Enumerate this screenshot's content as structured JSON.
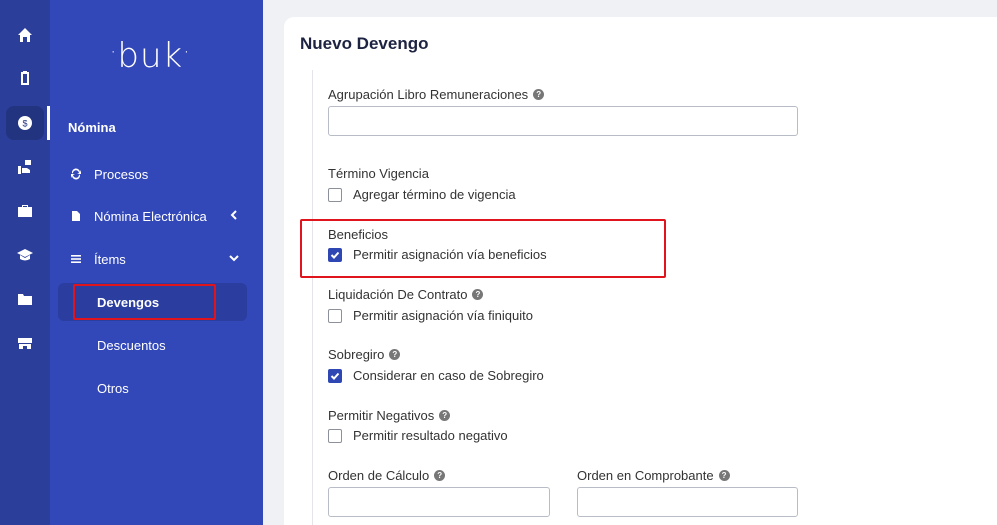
{
  "rail": {
    "icons": [
      "home-icon",
      "clipboard-icon",
      "dollar-icon",
      "hand-coin-icon",
      "briefcase-icon",
      "graduation-cap-icon",
      "folder-icon",
      "store-icon"
    ]
  },
  "nav": {
    "logo": "buk",
    "section": "Nómina",
    "items": [
      {
        "label": "Procesos",
        "icon": "sync-icon"
      },
      {
        "label": "Nómina Electrónica",
        "icon": "document-icon"
      },
      {
        "label": "Ítems",
        "icon": "list-icon"
      }
    ],
    "sub_items": [
      {
        "label": "Devengos"
      },
      {
        "label": "Descuentos"
      },
      {
        "label": "Otros"
      }
    ]
  },
  "form": {
    "title": "Nuevo Devengo",
    "agrupacion_label": "Agrupación Libro Remuneraciones",
    "agrupacion_value": "",
    "termino_label": "Término Vigencia",
    "termino_check": "Agregar término de vigencia",
    "beneficios_label": "Beneficios",
    "beneficios_check": "Permitir asignación vía beneficios",
    "liquidacion_label": "Liquidación De Contrato",
    "liquidacion_check": "Permitir asignación vía finiquito",
    "sobregiro_label": "Sobregiro",
    "sobregiro_check": "Considerar en caso de Sobregiro",
    "negativos_label": "Permitir Negativos",
    "negativos_check": "Permitir resultado negativo",
    "orden_calculo_label": "Orden de Cálculo",
    "orden_calculo_value": "",
    "orden_comprobante_label": "Orden en Comprobante",
    "orden_comprobante_value": "",
    "help_glyph": "?"
  },
  "colors": {
    "rail_bg": "#2a3e9a",
    "nav_bg": "#3348b8",
    "highlight": "#e0141c",
    "checkbox": "#2f47b3"
  }
}
